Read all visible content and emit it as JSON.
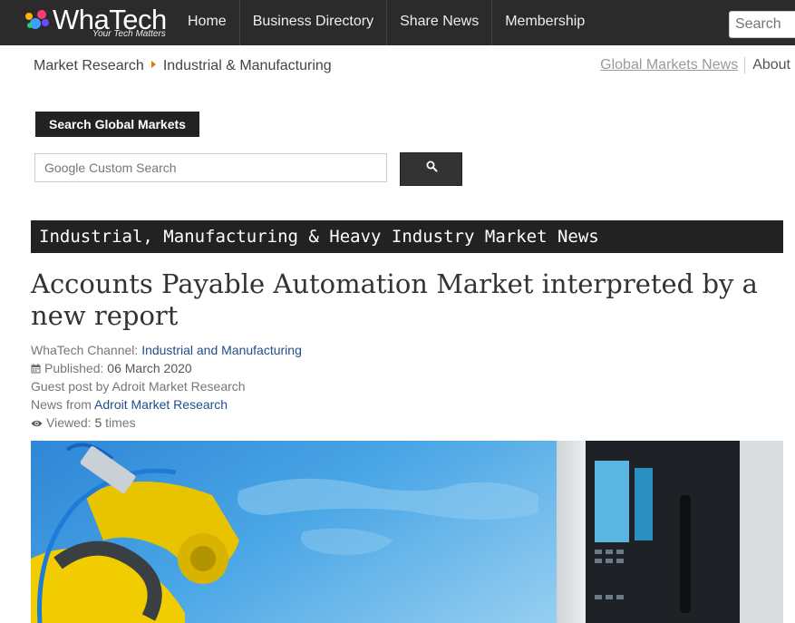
{
  "site": {
    "brand": "WhaTech",
    "tagline": "Your Tech Matters"
  },
  "nav": {
    "links": [
      "Home",
      "Business Directory",
      "Share News",
      "Membership"
    ],
    "search_placeholder": "Search"
  },
  "breadcrumb": {
    "items": [
      "Market Research",
      "Industrial & Manufacturing"
    ]
  },
  "header_links": {
    "global_markets": "Global Markets News",
    "about": "About"
  },
  "search_global": {
    "heading": "Search Global Markets",
    "placeholder": "Google Custom Search",
    "button_icon": "search-icon"
  },
  "section_title": "Industrial, Manufacturing & Heavy Industry Market News",
  "article": {
    "title": "Accounts Payable Automation Market interpreted by a new report",
    "channel_label": "WhaTech Channel:",
    "channel_value": "Industrial and Manufacturing",
    "published_label": "Published:",
    "published_value": "06 March 2020",
    "guest_post": "Guest post by Adroit Market Research",
    "news_from_label": "News from",
    "news_from_value": "Adroit Market Research",
    "viewed_label": "Viewed:",
    "viewed_count": "5",
    "viewed_suffix": "times"
  },
  "colors": {
    "nav_bg": "#2b2b2b",
    "link_blue": "#1f4e8c",
    "breadcrumb_arrow": "#e07b00"
  }
}
